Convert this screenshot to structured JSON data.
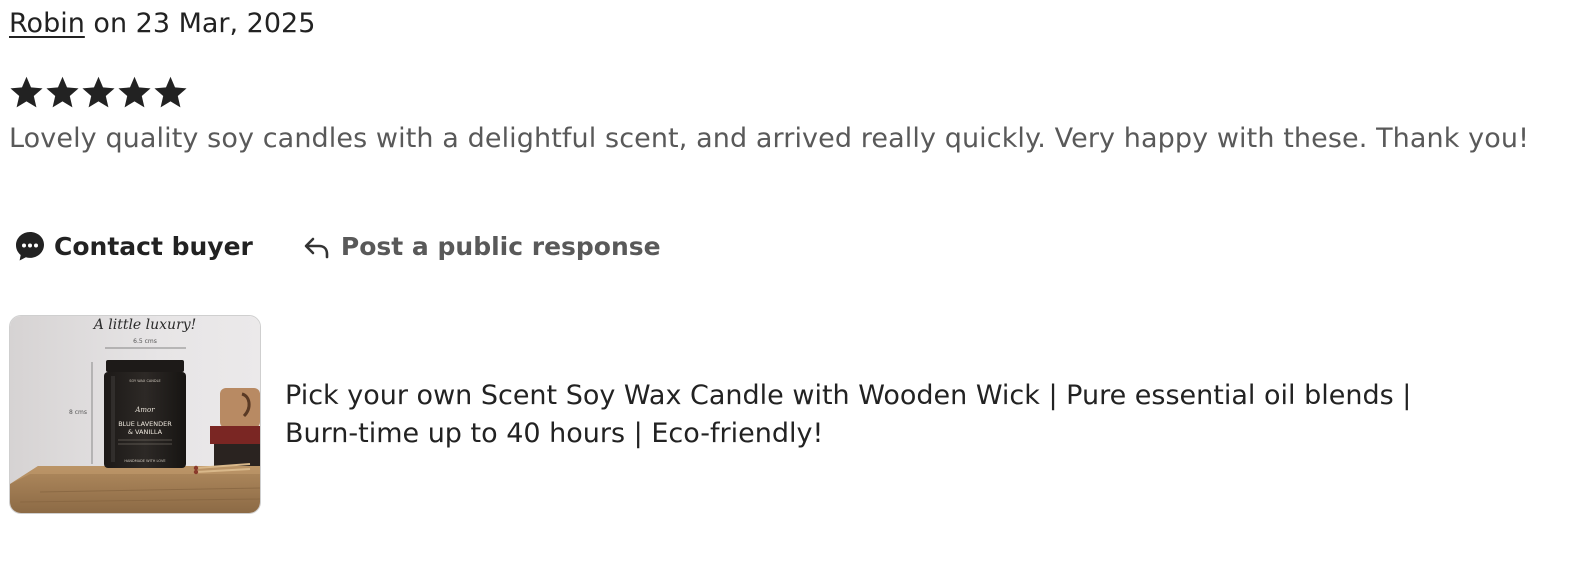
{
  "review": {
    "author": "Robin",
    "date_text": "on 23 Mar, 2025",
    "rating": 5,
    "rating_max": 5,
    "text": "Lovely quality soy candles with a delightful scent, and arrived really quickly. Very happy with these. Thank you!"
  },
  "actions": {
    "contact_buyer_label": "Contact buyer",
    "contact_buyer_icon": "chat-bubble-icon",
    "public_response_label": "Post a public response",
    "public_response_icon": "reply-arrow-icon"
  },
  "listing": {
    "title": "Pick your own Scent Soy Wax Candle with Wooden Wick | Pure essential oil blends | Burn-time up to 40 hours | Eco-friendly!",
    "image": {
      "tagline": "A little luxury!",
      "width_label": "6.5 cms",
      "height_label": "8 cms",
      "jar_brand_top": "SOY WAX CANDLE",
      "jar_brand_script": "Amor",
      "jar_scent_line1": "BLUE LAVENDER",
      "jar_scent_line2": "& VANILLA",
      "jar_footer": "HANDMADE WITH LOVE"
    }
  },
  "colors": {
    "text_primary": "#222222",
    "text_secondary": "#595959",
    "star": "#222222",
    "thumb_border": "#cfcfcf"
  }
}
